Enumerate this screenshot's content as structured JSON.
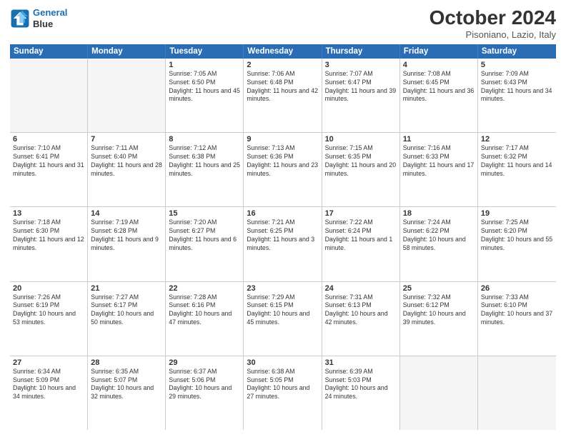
{
  "logo": {
    "line1": "General",
    "line2": "Blue"
  },
  "title": "October 2024",
  "subtitle": "Pisoniano, Lazio, Italy",
  "weekdays": [
    "Sunday",
    "Monday",
    "Tuesday",
    "Wednesday",
    "Thursday",
    "Friday",
    "Saturday"
  ],
  "rows": [
    [
      {
        "day": "",
        "sunrise": "",
        "sunset": "",
        "daylight": "",
        "empty": true
      },
      {
        "day": "",
        "sunrise": "",
        "sunset": "",
        "daylight": "",
        "empty": true
      },
      {
        "day": "1",
        "sunrise": "Sunrise: 7:05 AM",
        "sunset": "Sunset: 6:50 PM",
        "daylight": "Daylight: 11 hours and 45 minutes.",
        "empty": false
      },
      {
        "day": "2",
        "sunrise": "Sunrise: 7:06 AM",
        "sunset": "Sunset: 6:48 PM",
        "daylight": "Daylight: 11 hours and 42 minutes.",
        "empty": false
      },
      {
        "day": "3",
        "sunrise": "Sunrise: 7:07 AM",
        "sunset": "Sunset: 6:47 PM",
        "daylight": "Daylight: 11 hours and 39 minutes.",
        "empty": false
      },
      {
        "day": "4",
        "sunrise": "Sunrise: 7:08 AM",
        "sunset": "Sunset: 6:45 PM",
        "daylight": "Daylight: 11 hours and 36 minutes.",
        "empty": false
      },
      {
        "day": "5",
        "sunrise": "Sunrise: 7:09 AM",
        "sunset": "Sunset: 6:43 PM",
        "daylight": "Daylight: 11 hours and 34 minutes.",
        "empty": false
      }
    ],
    [
      {
        "day": "6",
        "sunrise": "Sunrise: 7:10 AM",
        "sunset": "Sunset: 6:41 PM",
        "daylight": "Daylight: 11 hours and 31 minutes.",
        "empty": false
      },
      {
        "day": "7",
        "sunrise": "Sunrise: 7:11 AM",
        "sunset": "Sunset: 6:40 PM",
        "daylight": "Daylight: 11 hours and 28 minutes.",
        "empty": false
      },
      {
        "day": "8",
        "sunrise": "Sunrise: 7:12 AM",
        "sunset": "Sunset: 6:38 PM",
        "daylight": "Daylight: 11 hours and 25 minutes.",
        "empty": false
      },
      {
        "day": "9",
        "sunrise": "Sunrise: 7:13 AM",
        "sunset": "Sunset: 6:36 PM",
        "daylight": "Daylight: 11 hours and 23 minutes.",
        "empty": false
      },
      {
        "day": "10",
        "sunrise": "Sunrise: 7:15 AM",
        "sunset": "Sunset: 6:35 PM",
        "daylight": "Daylight: 11 hours and 20 minutes.",
        "empty": false
      },
      {
        "day": "11",
        "sunrise": "Sunrise: 7:16 AM",
        "sunset": "Sunset: 6:33 PM",
        "daylight": "Daylight: 11 hours and 17 minutes.",
        "empty": false
      },
      {
        "day": "12",
        "sunrise": "Sunrise: 7:17 AM",
        "sunset": "Sunset: 6:32 PM",
        "daylight": "Daylight: 11 hours and 14 minutes.",
        "empty": false
      }
    ],
    [
      {
        "day": "13",
        "sunrise": "Sunrise: 7:18 AM",
        "sunset": "Sunset: 6:30 PM",
        "daylight": "Daylight: 11 hours and 12 minutes.",
        "empty": false
      },
      {
        "day": "14",
        "sunrise": "Sunrise: 7:19 AM",
        "sunset": "Sunset: 6:28 PM",
        "daylight": "Daylight: 11 hours and 9 minutes.",
        "empty": false
      },
      {
        "day": "15",
        "sunrise": "Sunrise: 7:20 AM",
        "sunset": "Sunset: 6:27 PM",
        "daylight": "Daylight: 11 hours and 6 minutes.",
        "empty": false
      },
      {
        "day": "16",
        "sunrise": "Sunrise: 7:21 AM",
        "sunset": "Sunset: 6:25 PM",
        "daylight": "Daylight: 11 hours and 3 minutes.",
        "empty": false
      },
      {
        "day": "17",
        "sunrise": "Sunrise: 7:22 AM",
        "sunset": "Sunset: 6:24 PM",
        "daylight": "Daylight: 11 hours and 1 minute.",
        "empty": false
      },
      {
        "day": "18",
        "sunrise": "Sunrise: 7:24 AM",
        "sunset": "Sunset: 6:22 PM",
        "daylight": "Daylight: 10 hours and 58 minutes.",
        "empty": false
      },
      {
        "day": "19",
        "sunrise": "Sunrise: 7:25 AM",
        "sunset": "Sunset: 6:20 PM",
        "daylight": "Daylight: 10 hours and 55 minutes.",
        "empty": false
      }
    ],
    [
      {
        "day": "20",
        "sunrise": "Sunrise: 7:26 AM",
        "sunset": "Sunset: 6:19 PM",
        "daylight": "Daylight: 10 hours and 53 minutes.",
        "empty": false
      },
      {
        "day": "21",
        "sunrise": "Sunrise: 7:27 AM",
        "sunset": "Sunset: 6:17 PM",
        "daylight": "Daylight: 10 hours and 50 minutes.",
        "empty": false
      },
      {
        "day": "22",
        "sunrise": "Sunrise: 7:28 AM",
        "sunset": "Sunset: 6:16 PM",
        "daylight": "Daylight: 10 hours and 47 minutes.",
        "empty": false
      },
      {
        "day": "23",
        "sunrise": "Sunrise: 7:29 AM",
        "sunset": "Sunset: 6:15 PM",
        "daylight": "Daylight: 10 hours and 45 minutes.",
        "empty": false
      },
      {
        "day": "24",
        "sunrise": "Sunrise: 7:31 AM",
        "sunset": "Sunset: 6:13 PM",
        "daylight": "Daylight: 10 hours and 42 minutes.",
        "empty": false
      },
      {
        "day": "25",
        "sunrise": "Sunrise: 7:32 AM",
        "sunset": "Sunset: 6:12 PM",
        "daylight": "Daylight: 10 hours and 39 minutes.",
        "empty": false
      },
      {
        "day": "26",
        "sunrise": "Sunrise: 7:33 AM",
        "sunset": "Sunset: 6:10 PM",
        "daylight": "Daylight: 10 hours and 37 minutes.",
        "empty": false
      }
    ],
    [
      {
        "day": "27",
        "sunrise": "Sunrise: 6:34 AM",
        "sunset": "Sunset: 5:09 PM",
        "daylight": "Daylight: 10 hours and 34 minutes.",
        "empty": false
      },
      {
        "day": "28",
        "sunrise": "Sunrise: 6:35 AM",
        "sunset": "Sunset: 5:07 PM",
        "daylight": "Daylight: 10 hours and 32 minutes.",
        "empty": false
      },
      {
        "day": "29",
        "sunrise": "Sunrise: 6:37 AM",
        "sunset": "Sunset: 5:06 PM",
        "daylight": "Daylight: 10 hours and 29 minutes.",
        "empty": false
      },
      {
        "day": "30",
        "sunrise": "Sunrise: 6:38 AM",
        "sunset": "Sunset: 5:05 PM",
        "daylight": "Daylight: 10 hours and 27 minutes.",
        "empty": false
      },
      {
        "day": "31",
        "sunrise": "Sunrise: 6:39 AM",
        "sunset": "Sunset: 5:03 PM",
        "daylight": "Daylight: 10 hours and 24 minutes.",
        "empty": false
      },
      {
        "day": "",
        "sunrise": "",
        "sunset": "",
        "daylight": "",
        "empty": true
      },
      {
        "day": "",
        "sunrise": "",
        "sunset": "",
        "daylight": "",
        "empty": true
      }
    ]
  ]
}
